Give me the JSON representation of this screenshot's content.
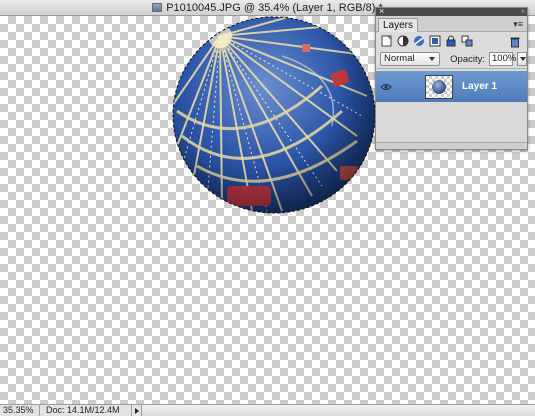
{
  "document": {
    "title": "P1010045.JPG @ 35.4% (Layer 1, RGB/8) *"
  },
  "status_bar": {
    "zoom": "35.35%",
    "doc_size": "Doc: 14.1M/12.4M"
  },
  "layers_panel": {
    "close_glyph": "×",
    "tab_label": "Layers",
    "menu_glyph": "▾≡",
    "blend_mode": "Normal",
    "opacity_label": "Opacity:",
    "opacity_value": "100%",
    "layers": [
      {
        "name": "Layer 1",
        "visible": true,
        "selected": true
      }
    ],
    "toolbar_icons": [
      "new-layer-icon",
      "adjustment-layer-icon",
      "mask-icon",
      "lock-transparency-icon",
      "lock-all-icon",
      "link-layers-icon",
      "trash-icon"
    ]
  },
  "colors": {
    "selection_blue": "#5a87c6",
    "sky_blue": "#2b55a8"
  }
}
